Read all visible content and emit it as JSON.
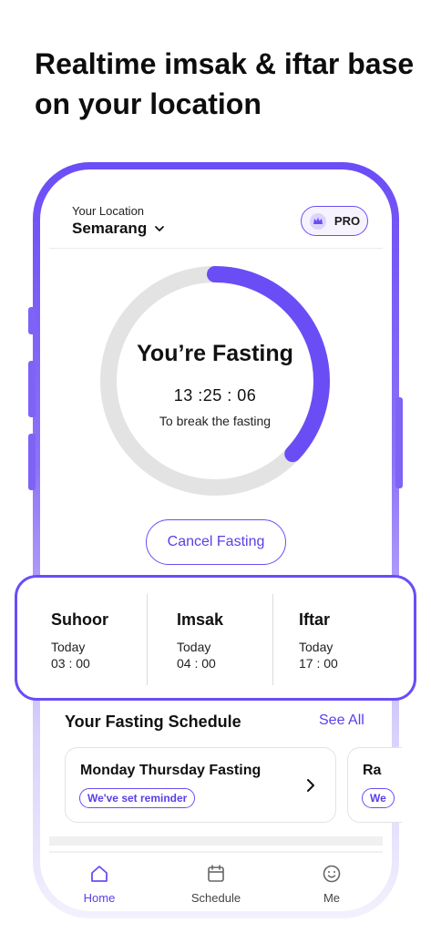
{
  "headline": "Realtime imsak & iftar base on your location",
  "location": {
    "label": "Your Location",
    "value": "Semarang"
  },
  "pro_badge": {
    "label": "PRO"
  },
  "fasting": {
    "title": "You’re Fasting",
    "timer": "13 :25 : 06",
    "subtitle": "To break the fasting",
    "progress_fraction": 0.37,
    "colors": {
      "progress": "#6b4df5",
      "track": "#e3e3e3"
    }
  },
  "cancel_button": "Cancel Fasting",
  "times": [
    {
      "name": "Suhoor",
      "day": "Today",
      "time": "03 : 00"
    },
    {
      "name": "Imsak",
      "day": "Today",
      "time": "04 : 00"
    },
    {
      "name": "Iftar",
      "day": "Today",
      "time": "17 : 00"
    }
  ],
  "schedule": {
    "title": "Your Fasting Schedule",
    "see_all": "See All",
    "cards": [
      {
        "name": "Monday Thursday Fasting",
        "tag": "We've set reminder"
      },
      {
        "name": "Ra",
        "tag": "We"
      }
    ]
  },
  "nav": [
    {
      "label": "Home",
      "icon": "home-icon",
      "active": true
    },
    {
      "label": "Schedule",
      "icon": "calendar-icon",
      "active": false
    },
    {
      "label": "Me",
      "icon": "smile-icon",
      "active": false
    }
  ],
  "accent_color": "#6b4df5"
}
